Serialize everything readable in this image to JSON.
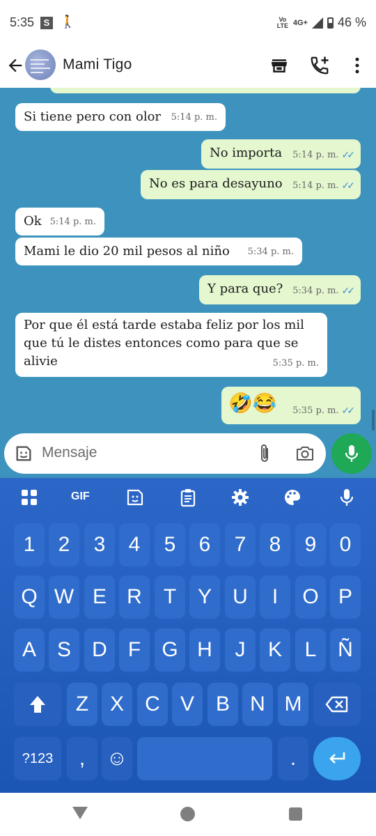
{
  "status_bar": {
    "time": "5:35",
    "s_badge": "S",
    "walk_glyph": "🚶",
    "volte_label": "Vo\nLTE",
    "network": "4G+",
    "battery": "46 %"
  },
  "header": {
    "contact_name": "Mami Tigo",
    "icons": [
      "back-arrow-icon",
      "store-icon",
      "add-call-icon",
      "more-vert-icon"
    ]
  },
  "messages": [
    {
      "dir": "in",
      "text": "Si tiene pero con olor",
      "time": "5:14 p. m."
    },
    {
      "dir": "out",
      "text": "No importa",
      "time": "5:14 p. m.",
      "ticks": "✓✓"
    },
    {
      "dir": "out",
      "text": "No es para desayuno",
      "time": "5:14 p. m.",
      "ticks": "✓✓"
    },
    {
      "dir": "in",
      "text": "Ok",
      "time": "5:14 p. m."
    },
    {
      "dir": "in",
      "text": "Mami le dio 20 mil pesos al niño",
      "time": "5:34 p. m."
    },
    {
      "dir": "out",
      "text": "Y para que?",
      "time": "5:34 p. m.",
      "ticks": "✓✓"
    },
    {
      "dir": "in",
      "text": "Por que él está tarde estaba feliz por los mil que tú le distes entonces como para que se alivie",
      "time": "5:35 p. m."
    },
    {
      "dir": "out",
      "text": "🤣😂",
      "time": "5:35 p. m.",
      "ticks": "✓✓"
    }
  ],
  "input": {
    "placeholder": "Mensaje",
    "icons": [
      "sticker-icon",
      "attach-icon",
      "camera-icon",
      "mic-icon"
    ]
  },
  "keyboard": {
    "toolbar": [
      "apps-grid-icon",
      "gif-icon",
      "sticker-icon",
      "clipboard-icon",
      "settings-icon",
      "palette-icon",
      "mic-icon"
    ],
    "gif_label": "GIF",
    "row_numbers": [
      "1",
      "2",
      "3",
      "4",
      "5",
      "6",
      "7",
      "8",
      "9",
      "0"
    ],
    "row_q": [
      "Q",
      "W",
      "E",
      "R",
      "T",
      "Y",
      "U",
      "I",
      "O",
      "P"
    ],
    "row_a": [
      "A",
      "S",
      "D",
      "F",
      "G",
      "H",
      "J",
      "K",
      "L",
      "Ñ"
    ],
    "row_z": [
      "Z",
      "X",
      "C",
      "V",
      "B",
      "N",
      "M"
    ],
    "symbols_label": "?123",
    "comma": ",",
    "period": ".",
    "emoji_glyph": "☺"
  },
  "colors": {
    "chat_bg": "#3d93bd",
    "incoming": "#ffffff",
    "outgoing": "#e4f7cf",
    "send_green": "#1fa855",
    "keyboard_blue": "#2c67c8",
    "read_ticks": "#3b8fd6"
  }
}
